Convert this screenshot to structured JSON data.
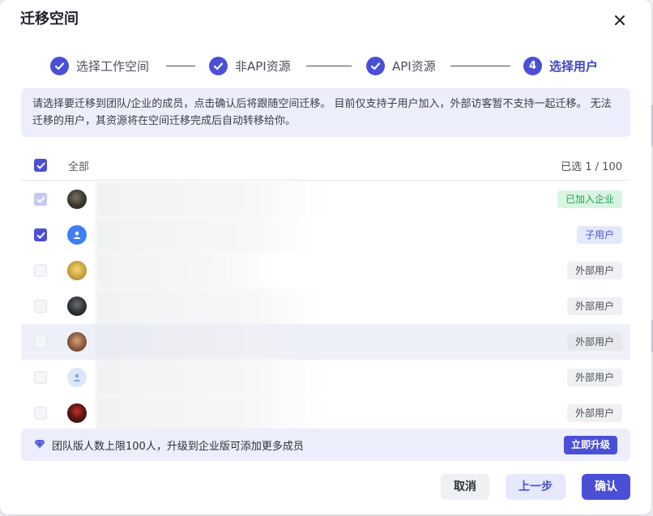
{
  "dialog": {
    "title": "迁移空间"
  },
  "steps": [
    {
      "label": "选择工作空间",
      "state": "done"
    },
    {
      "label": "非API资源",
      "state": "done"
    },
    {
      "label": "API资源",
      "state": "done"
    },
    {
      "label": "选择用户",
      "state": "active",
      "number": "4"
    }
  ],
  "notice": "请选择要迁移到团队/企业的成员，点击确认后将跟随空间迁移。 目前仅支持子用户加入，外部访客暂不支持一起迁移。 无法迁移的用户，其资源将在空间迁移完成后自动转移给你。",
  "list": {
    "select_all_label": "全部",
    "selected_count": "已选 1 / 100",
    "rows": [
      {
        "checked": true,
        "disabled": true,
        "avatar": "photo-dark",
        "badge": "已加入企业",
        "badge_kind": "green"
      },
      {
        "checked": true,
        "disabled": false,
        "avatar": "default-user",
        "badge": "子用户",
        "badge_kind": "blue"
      },
      {
        "checked": false,
        "disabled": true,
        "avatar": "photo-yellow",
        "badge": "外部用户",
        "badge_kind": "gray"
      },
      {
        "checked": false,
        "disabled": true,
        "avatar": "photo-dark",
        "badge": "外部用户",
        "badge_kind": "gray"
      },
      {
        "checked": false,
        "disabled": true,
        "avatar": "photo-brown",
        "badge": "外部用户",
        "badge_kind": "gray"
      },
      {
        "checked": false,
        "disabled": true,
        "avatar": "default-user-light",
        "badge": "外部用户",
        "badge_kind": "gray"
      },
      {
        "checked": false,
        "disabled": true,
        "avatar": "photo-red",
        "badge": "外部用户",
        "badge_kind": "gray"
      }
    ]
  },
  "footer_bar": {
    "text": "团队版人数上限100人，升级到企业版可添加更多成员",
    "upgrade_label": "立即升级"
  },
  "buttons": {
    "cancel": "取消",
    "prev": "上一步",
    "confirm": "确认"
  },
  "colors": {
    "accent": "#4b4fd6",
    "green": "#21a356"
  }
}
